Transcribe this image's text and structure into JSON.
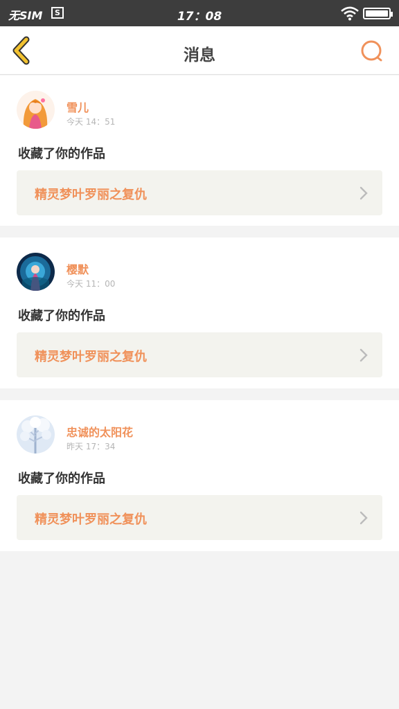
{
  "status_bar": {
    "carrier": "无SIM",
    "sim_icon": "S",
    "time": "17：08",
    "icons": [
      "wifi-icon",
      "battery-icon"
    ]
  },
  "nav": {
    "title": "消息",
    "back_icon": "chevron-left-icon",
    "search_icon": "search-icon",
    "accent_color": "#f0915a",
    "back_color": "#f2c230"
  },
  "messages": [
    {
      "user": "雪儿",
      "time": "今天 14：51",
      "action": "收藏了你的作品",
      "work_title": "精灵梦叶罗丽之复仇",
      "avatar": "avatar-anime-girl-orange"
    },
    {
      "user": "樱默",
      "time": "今天 11：00",
      "action": "收藏了你的作品",
      "work_title": "精灵梦叶罗丽之复仇",
      "avatar": "avatar-anime-girl-blue"
    },
    {
      "user": "忠诚的太阳花",
      "time": "昨天 17：34",
      "action": "收藏了你的作品",
      "work_title": "精灵梦叶罗丽之复仇",
      "avatar": "avatar-snowy-tree"
    }
  ]
}
